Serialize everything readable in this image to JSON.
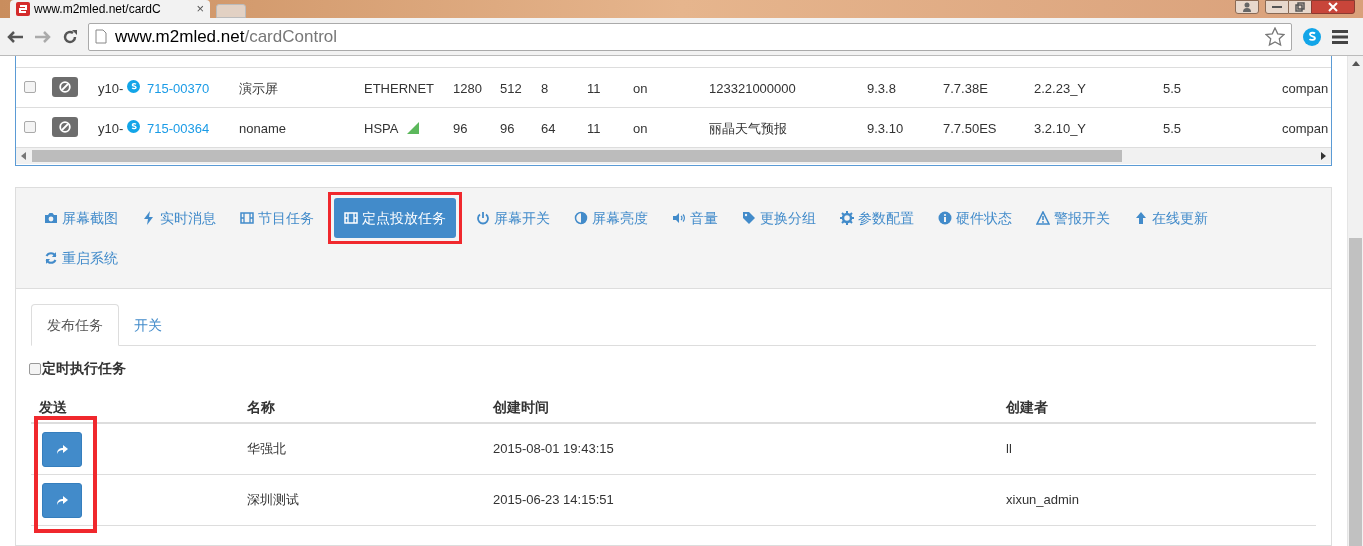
{
  "browser": {
    "tab_title": "www.m2mled.net/cardC",
    "tab_close": "×",
    "url_host": "www.m2mled.net",
    "url_path": "/cardControl"
  },
  "device_table": {
    "rows": [
      {
        "checked": false,
        "prefix": "y10-",
        "id": "715-00370",
        "name": "演示屏",
        "network": "ETHERNET",
        "signal": false,
        "cells": [
          "1280",
          "512",
          "8",
          "11",
          "on",
          "123321000000",
          "9.3.8",
          "7.7.38E",
          "2.2.23_Y",
          "5.5",
          "compan"
        ]
      },
      {
        "checked": false,
        "prefix": "y10-",
        "id": "715-00364",
        "name": "noname",
        "network": "HSPA",
        "signal": true,
        "cells": [
          "96",
          "96",
          "64",
          "11",
          "on",
          "丽晶天气预报",
          "9.3.10",
          "7.7.50ES",
          "3.2.10_Y",
          "5.5",
          "compan"
        ]
      }
    ]
  },
  "actions": [
    {
      "label": "屏幕截图",
      "selected": false,
      "highlighted": false
    },
    {
      "label": "实时消息",
      "selected": false,
      "highlighted": false
    },
    {
      "label": "节目任务",
      "selected": false,
      "highlighted": false
    },
    {
      "label": "定点投放任务",
      "selected": true,
      "highlighted": true
    },
    {
      "label": "屏幕开关",
      "selected": false,
      "highlighted": false
    },
    {
      "label": "屏幕亮度",
      "selected": false,
      "highlighted": false
    },
    {
      "label": "音量",
      "selected": false,
      "highlighted": false
    },
    {
      "label": "更换分组",
      "selected": false,
      "highlighted": false
    },
    {
      "label": "参数配置",
      "selected": false,
      "highlighted": false
    },
    {
      "label": "硬件状态",
      "selected": false,
      "highlighted": false
    },
    {
      "label": "警报开关",
      "selected": false,
      "highlighted": false
    },
    {
      "label": "在线更新",
      "selected": false,
      "highlighted": false
    },
    {
      "label": "重启系统",
      "selected": false,
      "highlighted": false
    }
  ],
  "tabs": [
    {
      "label": "发布任务",
      "selected": true
    },
    {
      "label": "开关",
      "selected": false
    }
  ],
  "scheduled_checkbox": {
    "label": "定时执行任务",
    "checked": false
  },
  "task_table": {
    "columns": [
      "发送",
      "名称",
      "创建时间",
      "创建者"
    ],
    "send_column_highlighted": true,
    "rows": [
      {
        "name": "华强北",
        "created": "2015-08-01 19:43:15",
        "creator": "ll"
      },
      {
        "name": "深圳测试",
        "created": "2015-06-23 14:15:51",
        "creator": "xixun_admin"
      }
    ]
  }
}
